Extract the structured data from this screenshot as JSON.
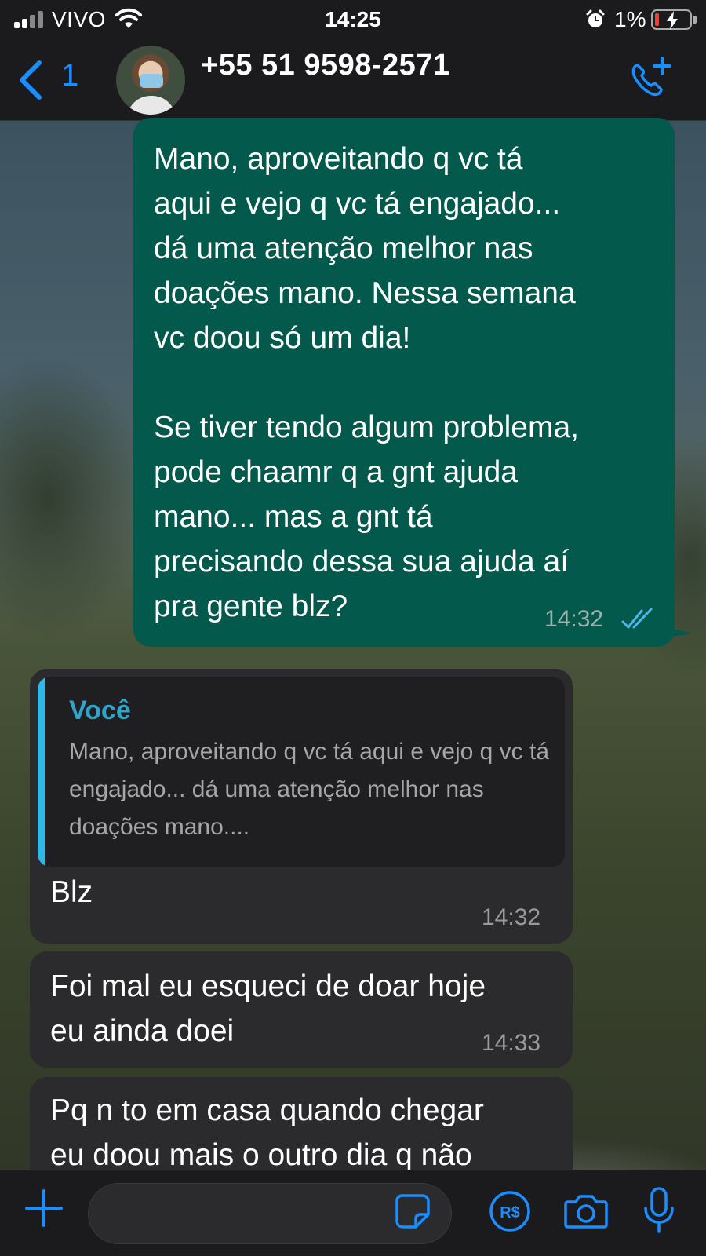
{
  "status_bar": {
    "carrier": "VIVO",
    "time": "14:25",
    "battery_percent": "1%",
    "icons": [
      "signal-icon",
      "wifi-icon",
      "alarm-icon",
      "battery-charging-icon"
    ]
  },
  "header": {
    "back_count": "1",
    "contact_name": "+55 51 9598-2571",
    "icons": [
      "back-chevron-icon",
      "add-call-icon"
    ]
  },
  "messages": [
    {
      "direction": "outgoing",
      "text": "Mano, aproveitando q vc tá\naqui e vejo q vc tá engajado...\ndá uma atenção melhor nas\ndoações mano. Nessa semana\nvc doou só um dia!\n\nSe tiver tendo algum problema,\npode chaamr q a gnt ajuda\nmano... mas a gnt tá\nprecisando dessa sua ajuda aí\npra gente blz?",
      "time": "14:32",
      "status": "read"
    },
    {
      "direction": "incoming",
      "quote_author": "Você",
      "quote_text": "Mano, aproveitando q vc tá aqui e vejo q vc tá engajado... dá uma atenção melhor nas doações mano....",
      "text": "Blz",
      "time": "14:32"
    },
    {
      "direction": "incoming",
      "text": "Foi mal eu esqueci de doar hoje\neu ainda doei",
      "time": "14:33"
    },
    {
      "direction": "incoming",
      "text": "Pq n to em casa quando chegar\neu doou mais o outro dia q não"
    }
  ],
  "composer": {
    "placeholder": "",
    "icons": [
      "plus-icon",
      "sticker-icon",
      "payment-icon",
      "camera-icon",
      "microphone-icon"
    ]
  },
  "colors": {
    "accent": "#1a8dff",
    "outgoing_bubble": "#03594c",
    "incoming_bubble": "#2b2b2d",
    "quote_bar": "#30b7e6",
    "read_ticks": "#4fb6ec",
    "battery_low": "#ff3b30"
  }
}
